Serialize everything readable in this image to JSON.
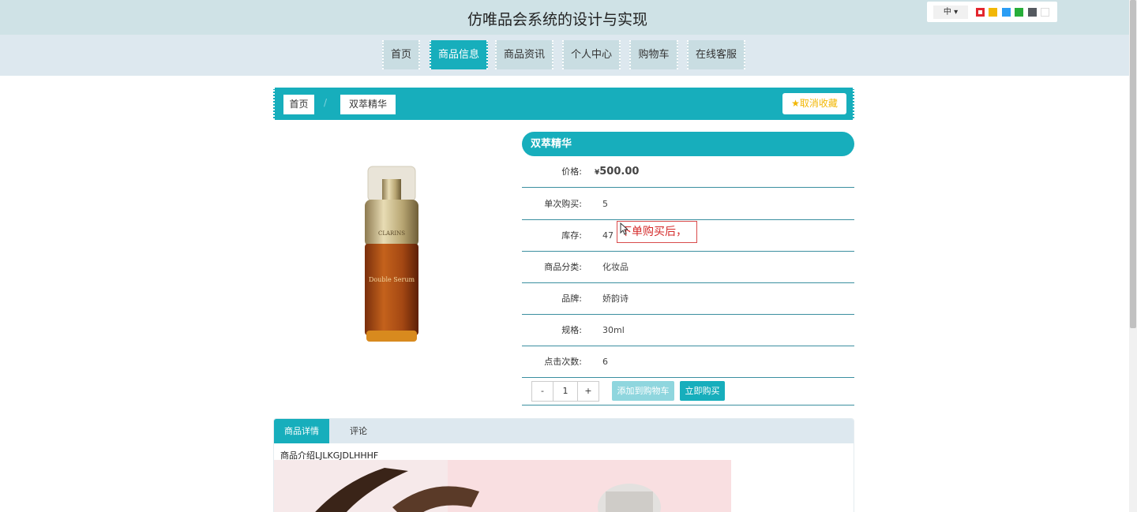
{
  "header": {
    "title": "仿唯品会系统的设计与实现",
    "lang": "中 ▾",
    "theme_colors": [
      "#e3262e",
      "#f2b705",
      "#2a9df4",
      "#27ae3a",
      "#555a60",
      "#ffffff"
    ]
  },
  "nav": {
    "items": [
      {
        "label": "首页"
      },
      {
        "label": "商品信息"
      },
      {
        "label": "商品资讯"
      },
      {
        "label": "个人中心"
      },
      {
        "label": "购物车"
      },
      {
        "label": "在线客服"
      }
    ],
    "active": "商品信息"
  },
  "breadcrumb": {
    "home": "首页",
    "sep": "/",
    "current": "双萃精华",
    "fav_label": "取消收藏"
  },
  "product": {
    "name": "双萃精华",
    "rows": [
      {
        "label": "价格:",
        "currency": "¥",
        "value": "500.00"
      },
      {
        "label": "单次购买:",
        "value": "5"
      },
      {
        "label": "库存:",
        "value": "47"
      },
      {
        "label": "商品分类:",
        "value": "化妆品"
      },
      {
        "label": "品牌:",
        "value": "娇韵诗"
      },
      {
        "label": "规格:",
        "value": "30ml"
      },
      {
        "label": "点击次数:",
        "value": "6"
      }
    ],
    "tip": "下单购买后，",
    "qty": {
      "minus": "-",
      "value": "1",
      "plus": "+"
    },
    "add_cart_label": "添加到购物车",
    "buy_now_label": "立即购买"
  },
  "tabs": {
    "items": [
      {
        "label": "商品详情"
      },
      {
        "label": "评论"
      }
    ],
    "active": "商品详情",
    "detail_text": "商品介绍LJLKGJDLHHHF"
  },
  "colors": {
    "accent": "#17aebc",
    "header_bg": "#cfe2e6",
    "nav_bg": "#dde8ef",
    "price": "#f2b705"
  }
}
